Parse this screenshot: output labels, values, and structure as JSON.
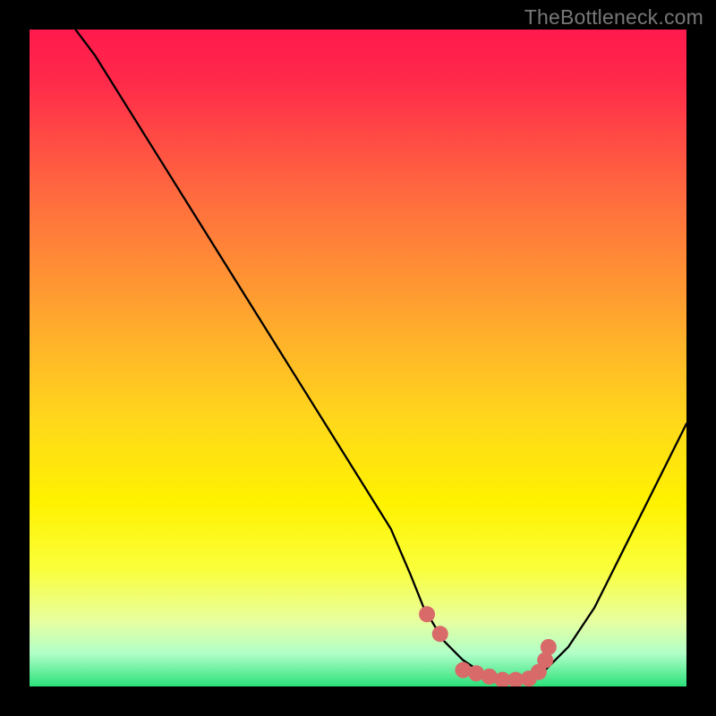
{
  "watermark": "TheBottleneck.com",
  "colors": {
    "page_bg": "#000000",
    "curve_stroke": "#000000",
    "marker_fill": "#d96a6a",
    "gradient_top": "#ff1a4d",
    "gradient_bottom": "#2be07a"
  },
  "chart_data": {
    "type": "line",
    "title": "",
    "xlabel": "",
    "ylabel": "",
    "xlim": [
      0,
      100
    ],
    "ylim": [
      0,
      100
    ],
    "series": [
      {
        "name": "bottleneck-curve",
        "x": [
          7,
          10,
          15,
          20,
          25,
          30,
          35,
          40,
          45,
          50,
          55,
          58,
          60,
          63,
          66,
          69,
          72,
          75,
          78,
          82,
          86,
          90,
          94,
          98,
          100
        ],
        "y": [
          100,
          96,
          88,
          80,
          72,
          64,
          56,
          48,
          40,
          32,
          24,
          17,
          12,
          7,
          4,
          2,
          1,
          1,
          2,
          6,
          12,
          20,
          28,
          36,
          40
        ]
      }
    ],
    "markers": {
      "name": "highlighted-points",
      "x": [
        60.5,
        62.5,
        66,
        68,
        70,
        72,
        74,
        76,
        77.5,
        78.5,
        79
      ],
      "y": [
        11,
        8,
        2.5,
        2,
        1.5,
        1,
        1,
        1.2,
        2.2,
        4,
        6
      ]
    }
  }
}
